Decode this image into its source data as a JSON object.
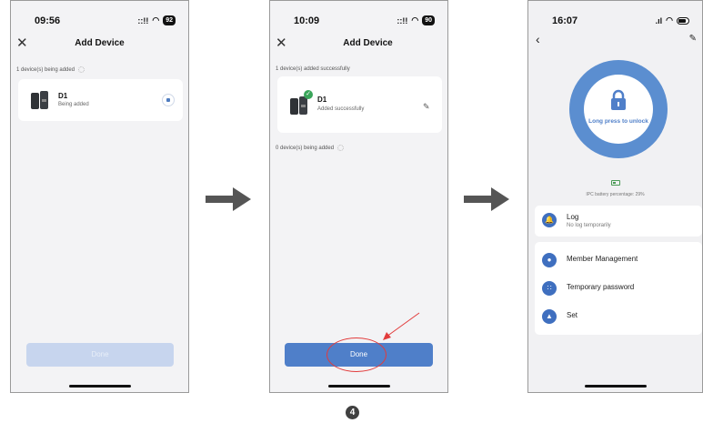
{
  "screen1": {
    "time": "09:56",
    "signal": "::!!",
    "battery": "92",
    "title": "Add Device",
    "adding_label": "1 device(s) being added",
    "device": {
      "name": "D1",
      "status": "Being added"
    },
    "done_label": "Done"
  },
  "screen2": {
    "time": "10:09",
    "signal": "::!!",
    "battery": "90",
    "title": "Add Device",
    "success_label": "1 device(s) added successfully",
    "device": {
      "name": "D1",
      "status": "Added successfully"
    },
    "pending_label": "0 device(s) being added",
    "done_label": "Done"
  },
  "screen3": {
    "time": "16:07",
    "lock_label": "Long press to unlock",
    "battery_pct_label": "IPC battery percentage: 29%",
    "log": {
      "title": "Log",
      "subtitle": "No log temporarily"
    },
    "menu": [
      "Member Management",
      "Temporary password",
      "Set"
    ]
  },
  "step_number": "4",
  "icons": {
    "close": "close-icon",
    "edit": "pencil-icon",
    "back": "chevron-left-icon",
    "lock": "padlock-icon",
    "bell": "bell-icon",
    "person": "person-icon",
    "keypad": "keypad-icon",
    "arrow": "right-arrow-icon"
  },
  "colors": {
    "primary": "#4f7fc9",
    "primary_disabled": "#c7d5ee",
    "success": "#3aa55a",
    "annotation": "#e23b3b",
    "arrow": "#555555"
  }
}
